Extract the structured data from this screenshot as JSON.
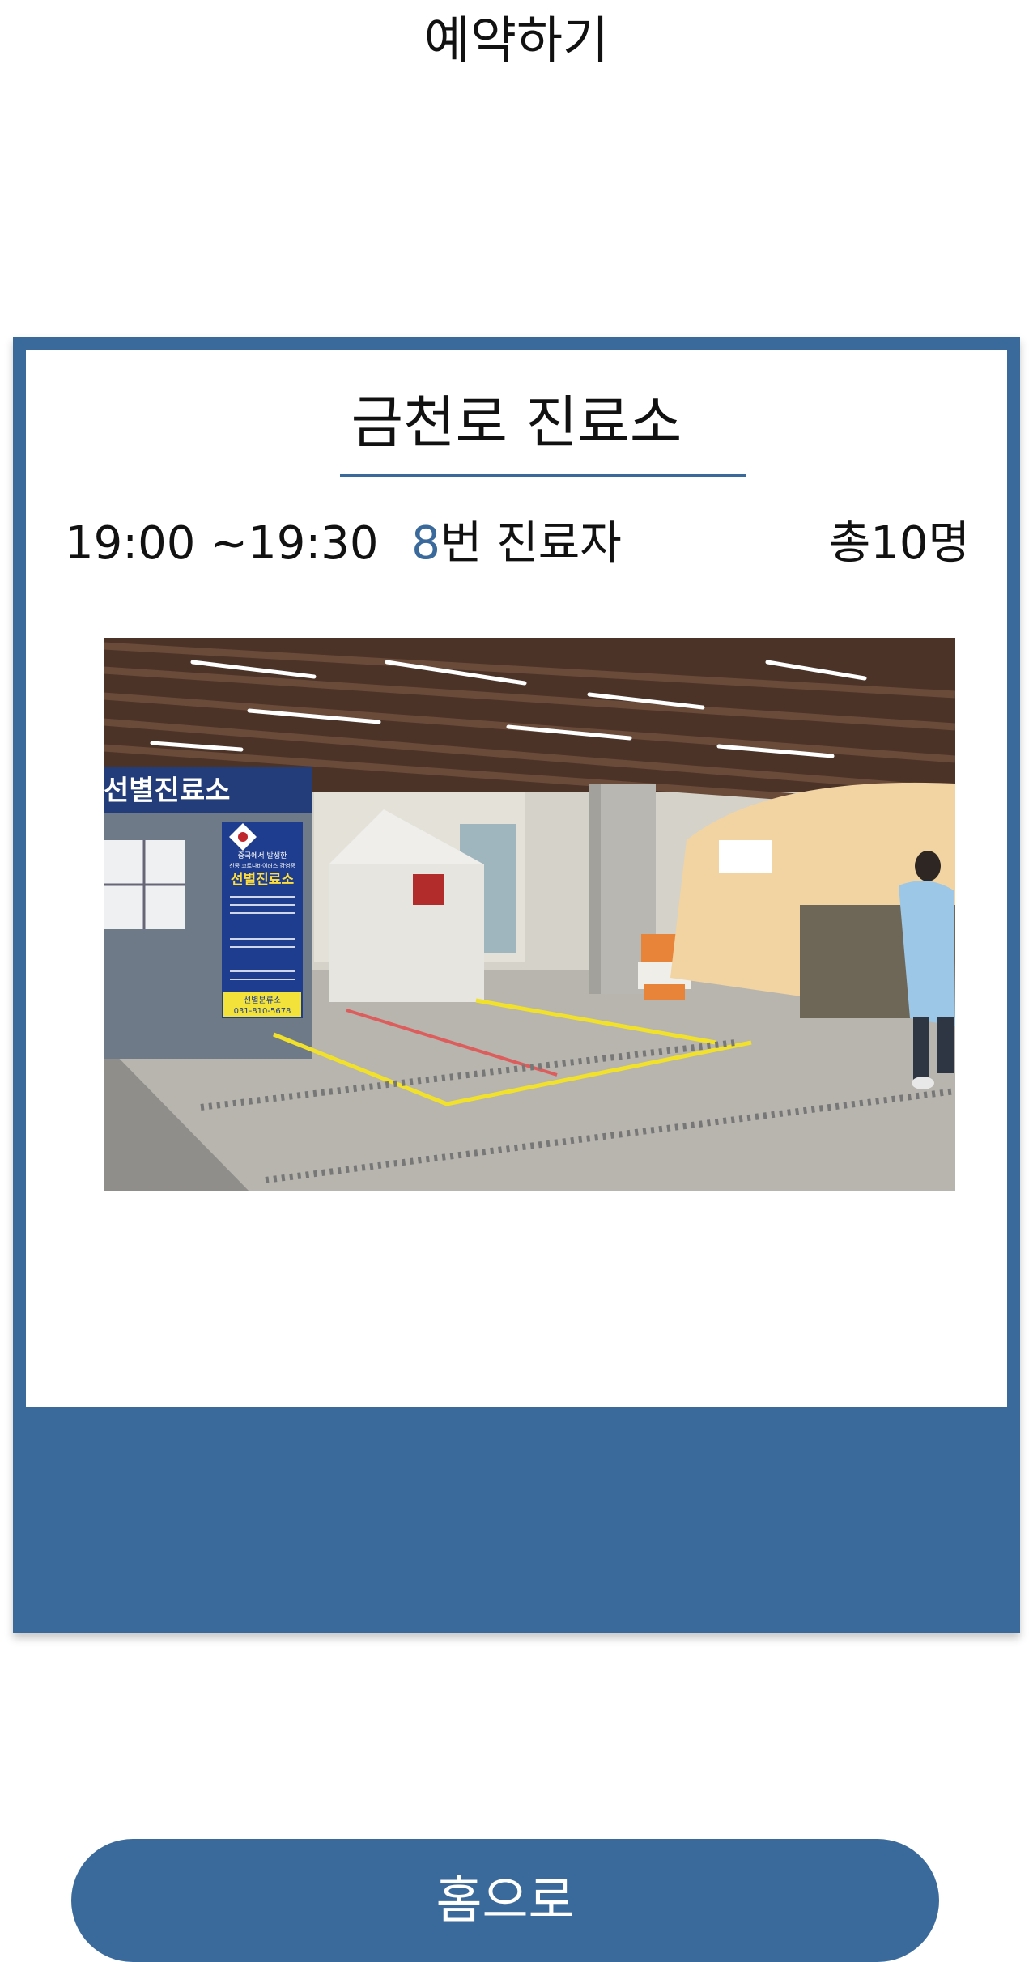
{
  "header": {
    "title": "예약하기"
  },
  "reservation": {
    "clinic_name": "금천로 진료소",
    "time_range": "19:00 ~19:30",
    "patient_number": "8",
    "patient_suffix": "번 진료자",
    "total": "총10명",
    "photo": {
      "booth_banner": "선별진료소",
      "sign_header": "중국에서 발생한",
      "sign_subheader": "신종 코로나바이러스 감염증",
      "sign_title": "선별진료소",
      "sign_footer_title": "선별분류소",
      "sign_phone": "031-810-5678"
    }
  },
  "footer": {
    "home_label": "홈으로"
  },
  "colors": {
    "accent": "#3a6a9b",
    "highlight": "#3a6a9b"
  }
}
